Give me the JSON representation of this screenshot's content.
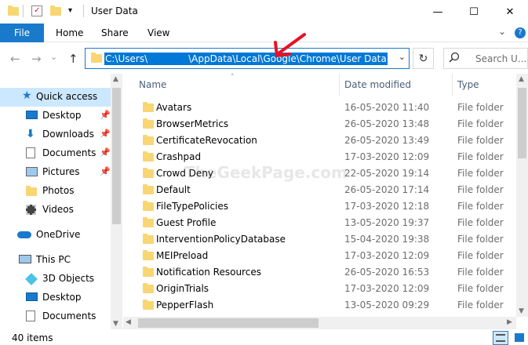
{
  "window": {
    "title": "User Data",
    "minimize_glyph": "—",
    "maximize_glyph": "☐",
    "close_glyph": "✕"
  },
  "ribbon": {
    "file": "File",
    "home": "Home",
    "share": "Share",
    "view": "View",
    "collapse_glyph": "⌄",
    "help_glyph": "?"
  },
  "address": {
    "path_part1": "C:\\Users\\",
    "path_part2": "\\AppData\\Local\\Google\\Chrome\\User Data",
    "dropdown_glyph": "⌄"
  },
  "search": {
    "placeholder": "Search U..."
  },
  "nav": {
    "back": "←",
    "forward": "→",
    "recent": "⌄",
    "up": "↑",
    "refresh": "↻",
    "items": [
      {
        "label": "Quick access",
        "pinned": false
      },
      {
        "label": "Desktop",
        "pinned": true
      },
      {
        "label": "Downloads",
        "pinned": true
      },
      {
        "label": "Documents",
        "pinned": true
      },
      {
        "label": "Pictures",
        "pinned": true
      },
      {
        "label": "Photos",
        "pinned": false
      },
      {
        "label": "Videos",
        "pinned": false
      },
      {
        "label": "OneDrive",
        "pinned": false
      },
      {
        "label": "This PC",
        "pinned": false
      },
      {
        "label": "3D Objects",
        "pinned": false
      },
      {
        "label": "Desktop",
        "pinned": false
      },
      {
        "label": "Documents",
        "pinned": false
      }
    ]
  },
  "columns": {
    "name": "Name",
    "date": "Date modified",
    "type": "Type"
  },
  "files": [
    {
      "name": "Avatars",
      "date": "16-05-2020 11:40",
      "type": "File folder"
    },
    {
      "name": "BrowserMetrics",
      "date": "26-05-2020 13:48",
      "type": "File folder"
    },
    {
      "name": "CertificateRevocation",
      "date": "26-05-2020 13:49",
      "type": "File folder"
    },
    {
      "name": "Crashpad",
      "date": "17-03-2020 12:09",
      "type": "File folder"
    },
    {
      "name": "Crowd Deny",
      "date": "22-05-2020 19:14",
      "type": "File folder"
    },
    {
      "name": "Default",
      "date": "26-05-2020 17:14",
      "type": "File folder"
    },
    {
      "name": "FileTypePolicies",
      "date": "17-03-2020 12:18",
      "type": "File folder"
    },
    {
      "name": "Guest Profile",
      "date": "13-05-2020 19:37",
      "type": "File folder"
    },
    {
      "name": "InterventionPolicyDatabase",
      "date": "15-04-2020 19:38",
      "type": "File folder"
    },
    {
      "name": "MEIPreload",
      "date": "17-03-2020 12:09",
      "type": "File folder"
    },
    {
      "name": "Notification Resources",
      "date": "26-05-2020 16:53",
      "type": "File folder"
    },
    {
      "name": "OriginTrials",
      "date": "17-03-2020 12:09",
      "type": "File folder"
    },
    {
      "name": "PepperFlash",
      "date": "13-05-2020 09:29",
      "type": "File folder"
    }
  ],
  "status": {
    "count": "40 items"
  },
  "watermark": "TheGeekPage.com",
  "colors": {
    "accent": "#1979ca",
    "selection": "#0078d7",
    "nav_selected": "#cce8ff",
    "folder": "#f7d673",
    "annotation_arrow": "#e81123"
  }
}
